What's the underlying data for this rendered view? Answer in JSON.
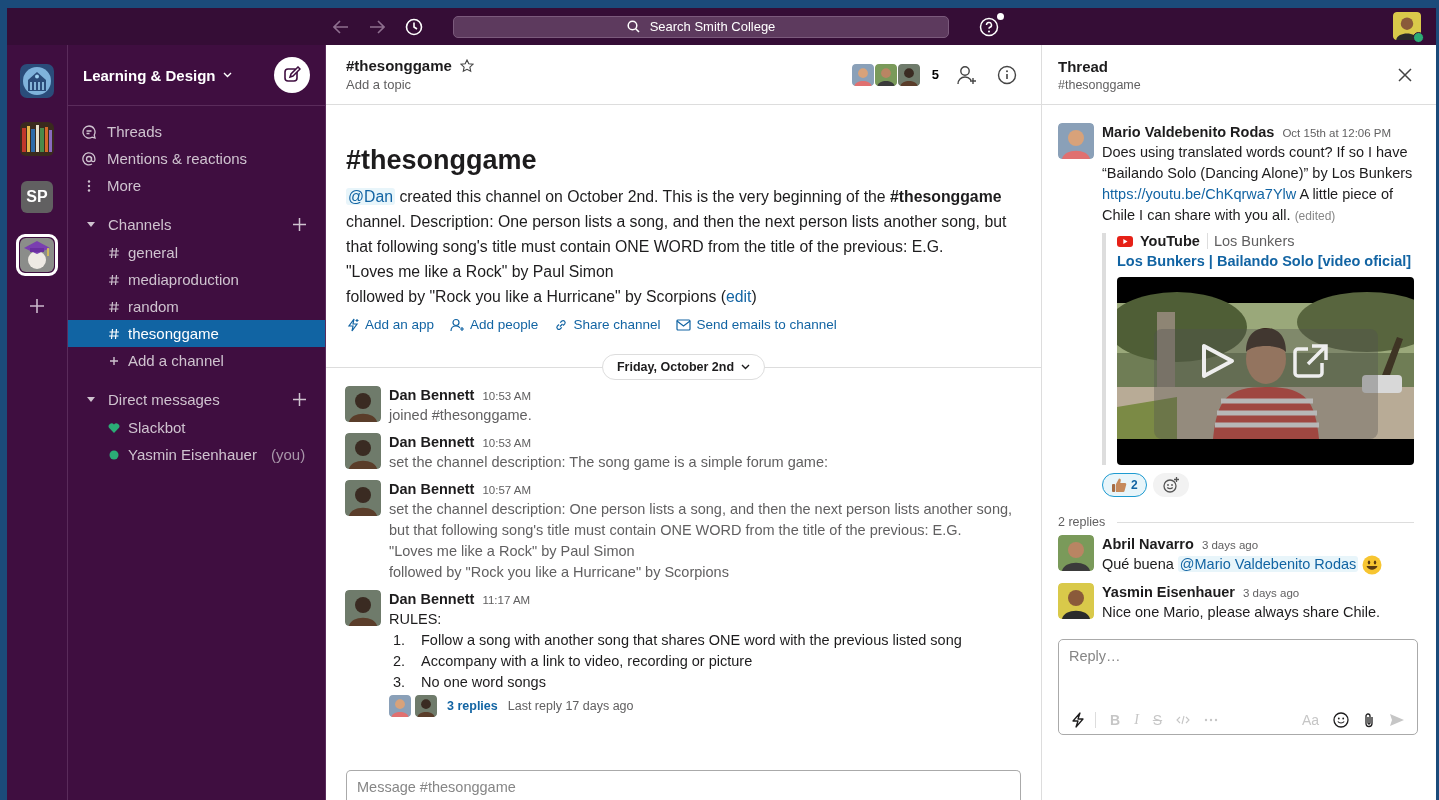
{
  "top_bar": {
    "search": {
      "placeholder": "Search Smith College"
    },
    "help": {
      "notification": true
    },
    "user": {
      "online": true
    }
  },
  "workspaces": [
    {
      "kind": "logo",
      "selected": false
    },
    {
      "kind": "picture",
      "selected": false
    },
    {
      "kind": "initials",
      "label": "SP",
      "selected": false
    },
    {
      "kind": "picture",
      "selected": true
    }
  ],
  "sidebar": {
    "workspace_name": "Learning & Design",
    "nav": [
      {
        "kind": "threads",
        "label": "Threads"
      },
      {
        "kind": "mentions",
        "label": "Mentions & reactions"
      },
      {
        "kind": "more",
        "label": "More"
      }
    ],
    "sections": [
      {
        "title": "Channels",
        "expanded": true,
        "items": [
          {
            "kind": "channel",
            "label": "general",
            "selected": false
          },
          {
            "kind": "channel",
            "label": "mediaproduction",
            "selected": false
          },
          {
            "kind": "channel",
            "label": "random",
            "selected": false
          },
          {
            "kind": "channel",
            "label": "thesonggame",
            "selected": true
          },
          {
            "kind": "add",
            "label": "Add a channel",
            "selected": false
          }
        ]
      },
      {
        "title": "Direct messages",
        "expanded": true,
        "items": [
          {
            "kind": "bot",
            "label": "Slackbot",
            "selected": false
          },
          {
            "kind": "person",
            "label": "Yasmin Eisenhauer",
            "note": "(you)",
            "selected": false
          }
        ]
      }
    ]
  },
  "channel": {
    "name": "#thesonggame",
    "starred": false,
    "topic_placeholder": "Add a topic",
    "member_count": "5"
  },
  "intro": {
    "title": "#thesonggame",
    "segments": [
      {
        "kind": "mention",
        "text": "@Dan"
      },
      {
        "kind": "text",
        "text": " created this channel on October 2nd. This is the very beginning of the **#thesonggame** channel. Description: One person lists a song, and then the next person lists another song, but that following song's title must contain ONE WORD from the title of the previous: E.G.\n\"Loves me like a Rock\" by Paul Simon\nfollowed by \"Rock you like a Hurricane\" by Scorpions ("
      },
      {
        "kind": "link",
        "text": "edit"
      },
      {
        "kind": "text",
        "text": ")"
      }
    ],
    "actions": [
      {
        "kind": "app",
        "label": "Add an app"
      },
      {
        "kind": "people",
        "label": "Add people"
      },
      {
        "kind": "share",
        "label": "Share channel"
      },
      {
        "kind": "email",
        "label": "Send emails to channel"
      }
    ]
  },
  "date_divider": "Friday, October 2nd",
  "messages": [
    {
      "author": "Dan Bennett",
      "time": "10:53 AM",
      "kind": "system",
      "text": "joined #thesonggame."
    },
    {
      "author": "Dan Bennett",
      "time": "10:53 AM",
      "kind": "system",
      "text": "set the channel description: The song game is a simple forum game:"
    },
    {
      "author": "Dan Bennett",
      "time": "10:57 AM",
      "kind": "system",
      "text": "set the channel description: One person lists a song, and then the next person lists another song, but that following song's title must contain ONE WORD from the title of the previous: E.G.\n\"Loves me like a Rock\" by Paul Simon\nfollowed by \"Rock you like a Hurricane\" by Scorpions"
    },
    {
      "author": "Dan Bennett",
      "time": "11:17 AM",
      "kind": "message",
      "text": "RULES:",
      "list": [
        {
          "number": "1.",
          "text": "Follow a song with another song that shares ONE word with the previous listed song"
        },
        {
          "number": "2.",
          "text": "Accompany with a link to video, recording or picture"
        },
        {
          "number": "3.",
          "text": "No one word songs"
        }
      ],
      "replies": {
        "count": "3 replies",
        "last": "Last reply 17 days ago"
      }
    }
  ],
  "composer": {
    "placeholder": "Message #thesonggame"
  },
  "thread": {
    "title": "Thread",
    "channel": "#thesonggame",
    "parent": {
      "author": "Mario Valdebenito Rodas",
      "time": "Oct 15th at 12:06 PM",
      "segments": [
        {
          "kind": "text",
          "text": "Does using translated words count? If so I have “Bailando Solo (Dancing Alone)” by Los Bunkers "
        },
        {
          "kind": "link",
          "text": "https://youtu.be/ChKqrwa7Ylw"
        },
        {
          "kind": "text",
          "text": " A little piece of Chile I can share with you all. "
        },
        {
          "kind": "edited",
          "text": "(edited)"
        }
      ],
      "attachment": {
        "service": "YouTube",
        "author": "Los Bunkers",
        "title": "Los Bunkers | Bailando Solo [video oficial]",
        "media": {
          "kind": "picture"
        }
      },
      "reactions": [
        {
          "kind": "thumbs_up",
          "count": "2",
          "selected": true
        }
      ]
    },
    "reply_count": "2 replies",
    "replies": [
      {
        "author": "Abril Navarro",
        "time": "3 days ago",
        "segments": [
          {
            "kind": "text",
            "text": "Qué buena "
          },
          {
            "kind": "mention",
            "text": "@Mario Valdebenito Rodas"
          },
          {
            "kind": "emoji_smile"
          }
        ]
      },
      {
        "author": "Yasmin Eisenhauer",
        "time": "3 days ago",
        "segments": [
          {
            "kind": "text",
            "text": "Nice one Mario, please always share Chile."
          }
        ]
      }
    ],
    "reply_box": {
      "placeholder": "Reply…",
      "toolbar": [
        {
          "kind": "shortcuts",
          "disabled": false
        },
        {
          "kind": "bold",
          "label": "B",
          "disabled": true
        },
        {
          "kind": "italic",
          "label": "I",
          "disabled": true
        },
        {
          "kind": "strike",
          "label": "S",
          "disabled": true
        },
        {
          "kind": "code",
          "disabled": true
        },
        {
          "kind": "more",
          "disabled": true
        },
        {
          "kind": "format",
          "label": "Aa",
          "disabled": true
        },
        {
          "kind": "emoji",
          "disabled": false
        },
        {
          "kind": "attach",
          "disabled": false
        },
        {
          "kind": "send",
          "disabled": true
        }
      ]
    }
  }
}
